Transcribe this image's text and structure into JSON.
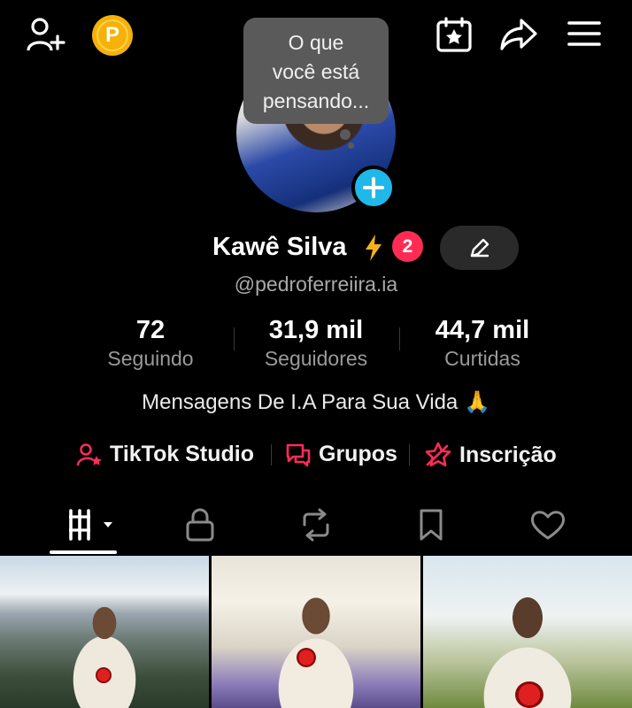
{
  "header": {
    "coin_letter": "P",
    "thought_bubble": [
      "O que",
      "você está",
      "pensando..."
    ]
  },
  "profile": {
    "display_name": "Kawê Silva",
    "notification_count": "2",
    "handle": "@pedroferreiira.ia",
    "bio": "Mensagens De I.A Para Sua Vida 🙏"
  },
  "stats": [
    {
      "value": "72",
      "label": "Seguindo"
    },
    {
      "value": "31,9 mil",
      "label": "Seguidores"
    },
    {
      "value": "44,7 mil",
      "label": "Curtidas"
    }
  ],
  "links": [
    {
      "label": "TikTok Studio",
      "icon": "user-star-icon"
    },
    {
      "label": "Grupos",
      "icon": "chat-bubbles-icon"
    },
    {
      "label": "Inscrição",
      "icon": "star-badge-icon"
    }
  ],
  "tabs": [
    "grid-videos-icon",
    "lock-icon",
    "repost-icon",
    "bookmark-icon",
    "heart-icon"
  ],
  "colors": {
    "accent": "#fe2c55",
    "plus": "#20b8e8",
    "coin": "#f6b10a"
  }
}
